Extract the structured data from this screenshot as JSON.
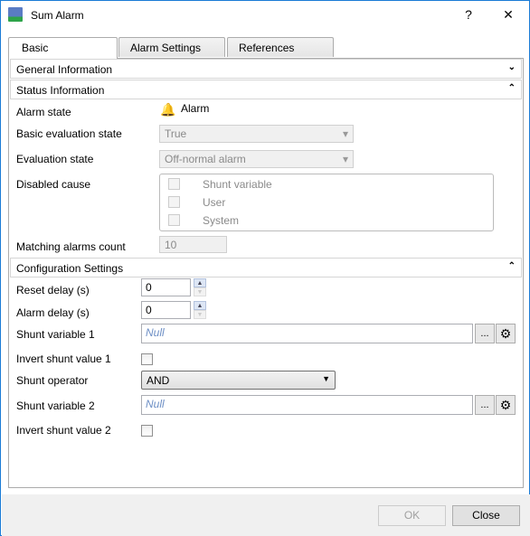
{
  "window": {
    "title": "Sum Alarm",
    "help_label": "?",
    "close_label": "✕",
    "accent": "#1a7bd6"
  },
  "tabs": [
    {
      "label": "Basic",
      "active": true
    },
    {
      "label": "Alarm Settings"
    },
    {
      "label": "References"
    }
  ],
  "sections": {
    "general": "General Information",
    "status": "Status Information",
    "config": "Configuration Settings"
  },
  "status": {
    "alarm_state_label": "Alarm state",
    "alarm_state_value": "Alarm",
    "alarm_icon": "bell-icon",
    "basic_eval_label": "Basic evaluation state",
    "basic_eval_value": "True",
    "eval_label": "Evaluation state",
    "eval_value": "Off-normal alarm",
    "disabled_label": "Disabled cause",
    "disabled_options": [
      "Shunt variable",
      "User",
      "System"
    ],
    "matching_label": "Matching alarms count",
    "matching_value": "10"
  },
  "config": {
    "reset_delay_label": "Reset delay (s)",
    "reset_delay_value": "0",
    "alarm_delay_label": "Alarm delay (s)",
    "alarm_delay_value": "0",
    "shunt1_label": "Shunt variable 1",
    "shunt1_value": "Null",
    "invert1_label": "Invert shunt value 1",
    "operator_label": "Shunt operator",
    "operator_value": "AND",
    "shunt2_label": "Shunt variable 2",
    "shunt2_value": "Null",
    "invert2_label": "Invert shunt value 2",
    "browse_label": "..."
  },
  "footer": {
    "ok": "OK",
    "close": "Close"
  }
}
